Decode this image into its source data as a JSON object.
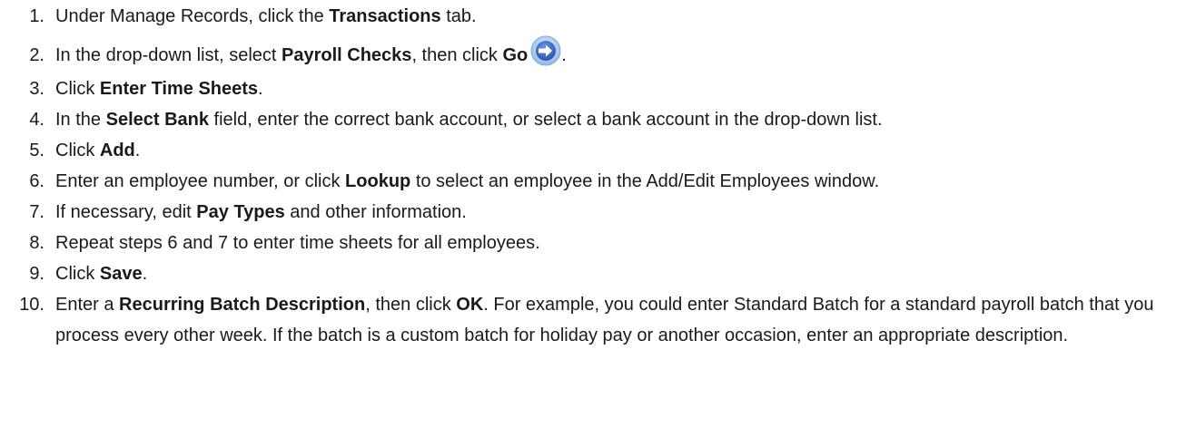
{
  "steps": [
    {
      "num": "1.",
      "parts": [
        "Under Manage Records, click the ",
        "Transactions",
        " tab."
      ]
    },
    {
      "num": "2.",
      "parts": [
        "In the drop-down list, select ",
        "Payroll Checks",
        ", then click ",
        "Go",
        "."
      ],
      "icon": "go-arrow-icon"
    },
    {
      "num": "3.",
      "parts": [
        "Click ",
        "Enter Time Sheets",
        "."
      ]
    },
    {
      "num": "4.",
      "parts": [
        "In the ",
        "Select Bank",
        " field, enter the correct bank account, or select a bank account in the drop-down list."
      ]
    },
    {
      "num": "5.",
      "parts": [
        "Click ",
        "Add",
        "."
      ]
    },
    {
      "num": "6.",
      "parts": [
        "Enter an employee number, or click ",
        "Lookup",
        " to select an employee in the Add/Edit Employees window."
      ]
    },
    {
      "num": "7.",
      "parts": [
        "If necessary, edit ",
        "Pay Types",
        " and other information."
      ]
    },
    {
      "num": "8.",
      "text": "Repeat steps 6 and 7 to enter time sheets for all employees."
    },
    {
      "num": "9.",
      "parts": [
        "Click ",
        "Save",
        "."
      ]
    },
    {
      "num": "10.",
      "parts": [
        "Enter a ",
        "Recurring Batch Description",
        ", then click ",
        "OK",
        ". For example, you could enter Standard Batch for a standard payroll batch that you process every other week. If the batch is a custom batch for holiday pay or another occasion, enter an appropriate description."
      ]
    }
  ],
  "colors": {
    "text": "#1a1a1a",
    "icon_fill": "#3b6fc4",
    "icon_ring": "#9ec3f0"
  }
}
